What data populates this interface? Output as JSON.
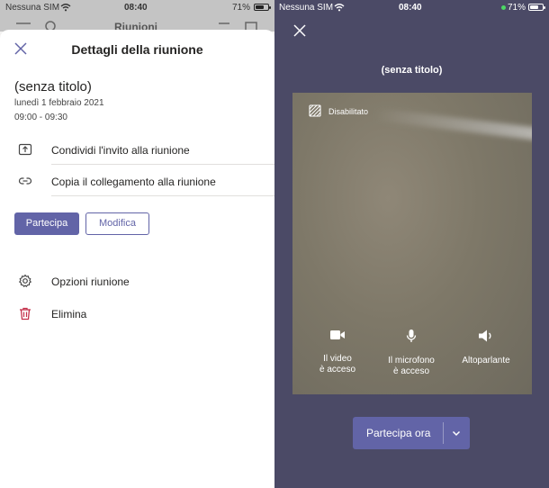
{
  "left": {
    "status": {
      "carrier": "Nessuna SIM",
      "time": "08:40",
      "battery": "71%",
      "battery_level": 0.71
    },
    "background_title": "Riunioni",
    "sheet": {
      "title": "Dettagli della riunione",
      "meeting_name": "(senza titolo)",
      "date": "lunedì 1 febbraio 2021",
      "time": "09:00 - 09:30",
      "share_invite": "Condividi l'invito alla riunione",
      "copy_link": "Copia il collegamento alla riunione",
      "join_button": "Partecipa",
      "edit_button": "Modifica",
      "options": "Opzioni riunione",
      "delete": "Elimina"
    },
    "accent": "#6264a7",
    "danger": "#c4314b"
  },
  "right": {
    "status": {
      "carrier": "Nessuna SIM",
      "time": "08:40",
      "battery": "71%",
      "battery_level": 0.71
    },
    "title": "(senza titolo)",
    "background_label": "Disabilitato",
    "controls": {
      "video": "Il video\nè acceso",
      "mic": "Il microfono\nè acceso",
      "speaker": "Altoparlante"
    },
    "join_now": "Partecipa ora",
    "bg_color": "#4b4a66"
  }
}
